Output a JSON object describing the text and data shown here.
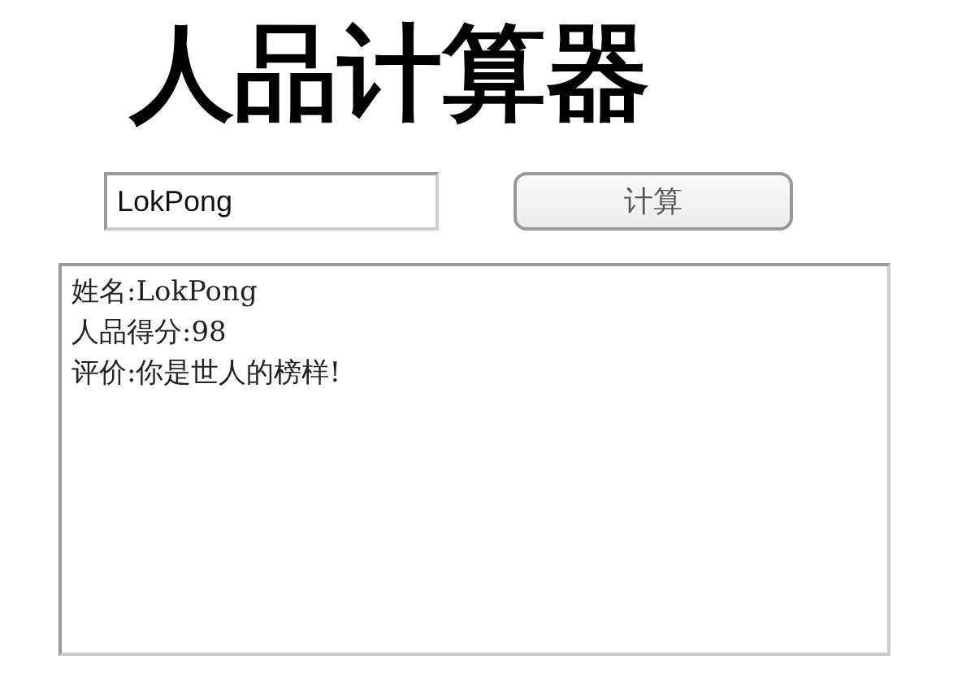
{
  "title": "人品计算器",
  "name_input": {
    "value": "LokPong"
  },
  "calculate_button": {
    "label": "计算"
  },
  "result_lines": [
    "姓名:LokPong",
    "人品得分:98",
    "评价:你是世人的榜样!"
  ]
}
